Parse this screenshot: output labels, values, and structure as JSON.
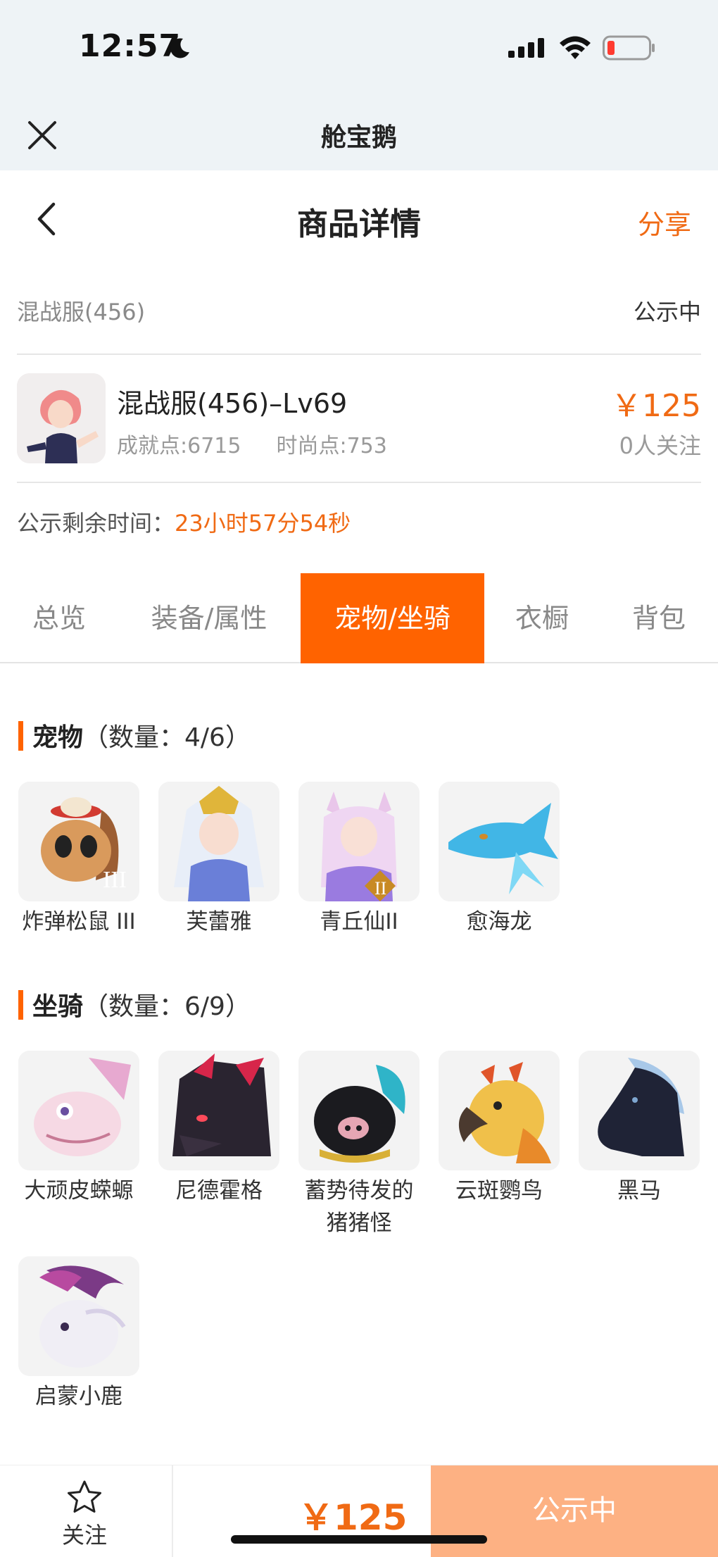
{
  "status_bar": {
    "time": "12:57"
  },
  "top_bar": {
    "app_title": "舱宝鹅"
  },
  "nav": {
    "title": "商品详情",
    "share_label": "分享"
  },
  "server": {
    "name": "混战服(456)",
    "status": "公示中"
  },
  "product": {
    "title": "混战服(456)–Lv69",
    "achievement": "成就点:6715",
    "fashion": "时尚点:753",
    "price": "￥125",
    "followers": "0人关注"
  },
  "countdown": {
    "label": "公示剩余时间：",
    "value": "23小时57分54秒"
  },
  "tabs": [
    {
      "label": "总览"
    },
    {
      "label": "装备/属性"
    },
    {
      "label": "宠物/坐骑",
      "active": true
    },
    {
      "label": "衣橱"
    },
    {
      "label": "背包"
    }
  ],
  "pets": {
    "title": "宠物",
    "count": "（数量：4/6）",
    "items": [
      {
        "name": "炸弹松鼠 III",
        "icon": "squirrel-pet-icon"
      },
      {
        "name": "芙蕾雅",
        "icon": "freya-pet-icon"
      },
      {
        "name": "青丘仙II",
        "icon": "fox-fairy-pet-icon"
      },
      {
        "name": "愈海龙",
        "icon": "sea-dragon-pet-icon"
      }
    ]
  },
  "mounts": {
    "title": "坐骑",
    "count": "（数量：6/9）",
    "items": [
      {
        "name": "大顽皮蝾螈",
        "icon": "salamander-mount-icon"
      },
      {
        "name": "尼德霍格",
        "icon": "nidhogg-mount-icon"
      },
      {
        "name": "蓄势待发的",
        "name2": "猪猪怪",
        "icon": "pig-mount-icon"
      },
      {
        "name": "云斑鹦鸟",
        "icon": "parrot-mount-icon"
      },
      {
        "name": "黑马",
        "icon": "black-horse-mount-icon"
      },
      {
        "name": "启蒙小鹿",
        "icon": "deer-mount-icon"
      }
    ]
  },
  "bottom_bar": {
    "follow_label": "关注",
    "price": "￥125",
    "action_label": "公示中"
  },
  "colors": {
    "accent": "#ff6300",
    "price": "#f06a14",
    "action_bg": "#fdb183"
  }
}
